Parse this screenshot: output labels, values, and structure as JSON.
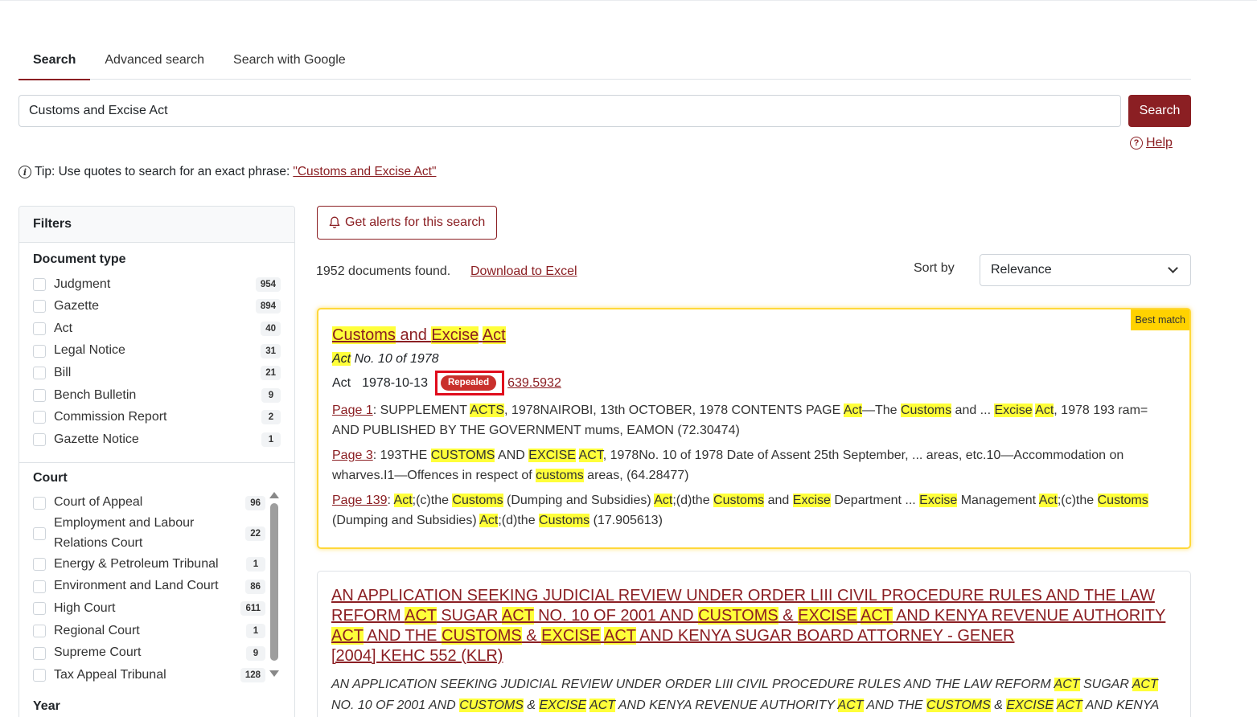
{
  "tabs": [
    {
      "label": "Search"
    },
    {
      "label": "Advanced search"
    },
    {
      "label": "Search with Google"
    }
  ],
  "search": {
    "value": "Customs and Excise Act",
    "button_label": "Search"
  },
  "help_label": "Help",
  "tip": {
    "prefix": "Tip: Use quotes to search for an exact phrase:",
    "phrase": "\"Customs and Excise Act\""
  },
  "filters": {
    "title": "Filters",
    "document_type": {
      "title": "Document type",
      "items": [
        {
          "label": "Judgment",
          "count": "954"
        },
        {
          "label": "Gazette",
          "count": "894"
        },
        {
          "label": "Act",
          "count": "40"
        },
        {
          "label": "Legal Notice",
          "count": "31"
        },
        {
          "label": "Bill",
          "count": "21"
        },
        {
          "label": "Bench Bulletin",
          "count": "9"
        },
        {
          "label": "Commission Report",
          "count": "2"
        },
        {
          "label": "Gazette Notice",
          "count": "1"
        }
      ]
    },
    "court": {
      "title": "Court",
      "items": [
        {
          "label": "Court of Appeal",
          "count": "96"
        },
        {
          "label": "Employment and Labour Relations Court",
          "count": "22"
        },
        {
          "label": "Energy & Petroleum Tribunal",
          "count": "1"
        },
        {
          "label": "Environment and Land Court",
          "count": "86"
        },
        {
          "label": "High Court",
          "count": "611"
        },
        {
          "label": "Regional Court",
          "count": "1"
        },
        {
          "label": "Supreme Court",
          "count": "9"
        },
        {
          "label": "Tax Appeal Tribunal",
          "count": "128"
        }
      ]
    },
    "year_title": "Year"
  },
  "alerts_label": "Get alerts for this search",
  "results_count": "1952 documents found.",
  "download_label": "Download to Excel",
  "sort": {
    "label": "Sort by",
    "value": "Relevance"
  },
  "results": [
    {
      "badge": "Best match",
      "title_parts": [
        {
          "t": "Customs",
          "h": true
        },
        {
          "t": " and ",
          "h": false
        },
        {
          "t": "Excise",
          "h": true
        },
        {
          "t": " ",
          "h": false
        },
        {
          "t": "Act",
          "h": true
        }
      ],
      "citation_parts": [
        {
          "t": "Act",
          "h": true
        },
        {
          "t": " No. 10 of 1978",
          "h": false
        }
      ],
      "doc_type": "Act",
      "date": "1978-10-13",
      "status": "Repealed",
      "score": "639.5932",
      "snippets": [
        {
          "page": "Page 1",
          "parts": [
            {
              "t": ": SUPPLEMENT ",
              "h": false
            },
            {
              "t": "ACTS",
              "h": true
            },
            {
              "t": ", 1978NAIROBI, 13th OCTOBER, 1978 CONTENTS PAGE ",
              "h": false
            },
            {
              "t": "Act",
              "h": true
            },
            {
              "t": "—The ",
              "h": false
            },
            {
              "t": "Customs",
              "h": true
            },
            {
              "t": " and ... ",
              "h": false
            },
            {
              "t": "Excise",
              "h": true
            },
            {
              "t": " ",
              "h": false
            },
            {
              "t": "Act",
              "h": true
            },
            {
              "t": ", 1978 193 ram= AND PUBLISHED BY THE GOVERNMENT mums, EAMON (72.30474)",
              "h": false
            }
          ]
        },
        {
          "page": "Page 3",
          "parts": [
            {
              "t": ": 193THE ",
              "h": false
            },
            {
              "t": "CUSTOMS",
              "h": true
            },
            {
              "t": " AND ",
              "h": false
            },
            {
              "t": "EXCISE",
              "h": true
            },
            {
              "t": " ",
              "h": false
            },
            {
              "t": "ACT",
              "h": true
            },
            {
              "t": ", 1978No. 10 of 1978 Date of Assent 25th September, ... areas, etc.10—Accommodation on wharves.I1—Offences in respect of ",
              "h": false
            },
            {
              "t": "customs",
              "h": true
            },
            {
              "t": " areas, (64.28477)",
              "h": false
            }
          ]
        },
        {
          "page": "Page 139",
          "parts": [
            {
              "t": ": ",
              "h": false
            },
            {
              "t": "Act",
              "h": true
            },
            {
              "t": ";(c)the ",
              "h": false
            },
            {
              "t": "Customs",
              "h": true
            },
            {
              "t": " (Dumping and Subsidies) ",
              "h": false
            },
            {
              "t": "Act",
              "h": true
            },
            {
              "t": ";(d)the ",
              "h": false
            },
            {
              "t": "Customs",
              "h": true
            },
            {
              "t": " and ",
              "h": false
            },
            {
              "t": "Excise",
              "h": true
            },
            {
              "t": " Department ... ",
              "h": false
            },
            {
              "t": "Excise",
              "h": true
            },
            {
              "t": " Management ",
              "h": false
            },
            {
              "t": "Act",
              "h": true
            },
            {
              "t": ";(c)the ",
              "h": false
            },
            {
              "t": "Customs",
              "h": true
            },
            {
              "t": " (Dumping and Subsidies) ",
              "h": false
            },
            {
              "t": "Act",
              "h": true
            },
            {
              "t": ";(d)the ",
              "h": false
            },
            {
              "t": "Customs",
              "h": true
            },
            {
              "t": " (17.905613)",
              "h": false
            }
          ]
        }
      ]
    },
    {
      "title_parts": [
        {
          "t": "AN APPLICATION SEEKING JUDICIAL REVIEW UNDER ORDER LIII CIVIL PROCEDURE RULES AND THE LAW REFORM ",
          "h": false
        },
        {
          "t": "ACT",
          "h": true
        },
        {
          "t": " SUGAR ",
          "h": false
        },
        {
          "t": "ACT",
          "h": true
        },
        {
          "t": " NO. 10 OF 2001 AND ",
          "h": false
        },
        {
          "t": "CUSTOMS",
          "h": true
        },
        {
          "t": " & ",
          "h": false
        },
        {
          "t": "EXCISE",
          "h": true
        },
        {
          "t": " ",
          "h": false
        },
        {
          "t": "ACT",
          "h": true
        },
        {
          "t": " AND KENYA REVENUE AUTHORITY ",
          "h": false
        },
        {
          "t": "ACT",
          "h": true
        },
        {
          "t": " AND THE ",
          "h": false
        },
        {
          "t": "CUSTOMS",
          "h": true
        },
        {
          "t": " & ",
          "h": false
        },
        {
          "t": "EXCISE",
          "h": true
        },
        {
          "t": " ",
          "h": false
        },
        {
          "t": "ACT",
          "h": true
        },
        {
          "t": " AND KENYA SUGAR BOARD ATTORNEY - GENER",
          "h": false
        }
      ],
      "subtitle": "[2004] KEHC 552 (KLR)",
      "snippet_parts": [
        {
          "t": "AN APPLICATION SEEKING JUDICIAL REVIEW UNDER ORDER LIII CIVIL PROCEDURE RULES AND THE LAW REFORM ",
          "h": false
        },
        {
          "t": "ACT",
          "h": true
        },
        {
          "t": " SUGAR ",
          "h": false
        },
        {
          "t": "ACT",
          "h": true
        },
        {
          "t": " NO. 10 OF 2001 AND ",
          "h": false
        },
        {
          "t": "CUSTOMS",
          "h": true
        },
        {
          "t": " & ",
          "h": false
        },
        {
          "t": "EXCISE",
          "h": true
        },
        {
          "t": " ",
          "h": false
        },
        {
          "t": "ACT",
          "h": true
        },
        {
          "t": " AND KENYA REVENUE AUTHORITY ",
          "h": false
        },
        {
          "t": "ACT",
          "h": true
        },
        {
          "t": " AND THE ",
          "h": false
        },
        {
          "t": "CUSTOMS",
          "h": true
        },
        {
          "t": " & ",
          "h": false
        },
        {
          "t": "EXCISE",
          "h": true
        },
        {
          "t": " ",
          "h": false
        },
        {
          "t": "ACT",
          "h": true
        },
        {
          "t": " AND KENYA",
          "h": false
        }
      ]
    }
  ],
  "colors": {
    "accent": "#8b1f23",
    "highlight": "#ffff3a",
    "best_match": "#ffd200",
    "repealed": "#c9302c"
  }
}
